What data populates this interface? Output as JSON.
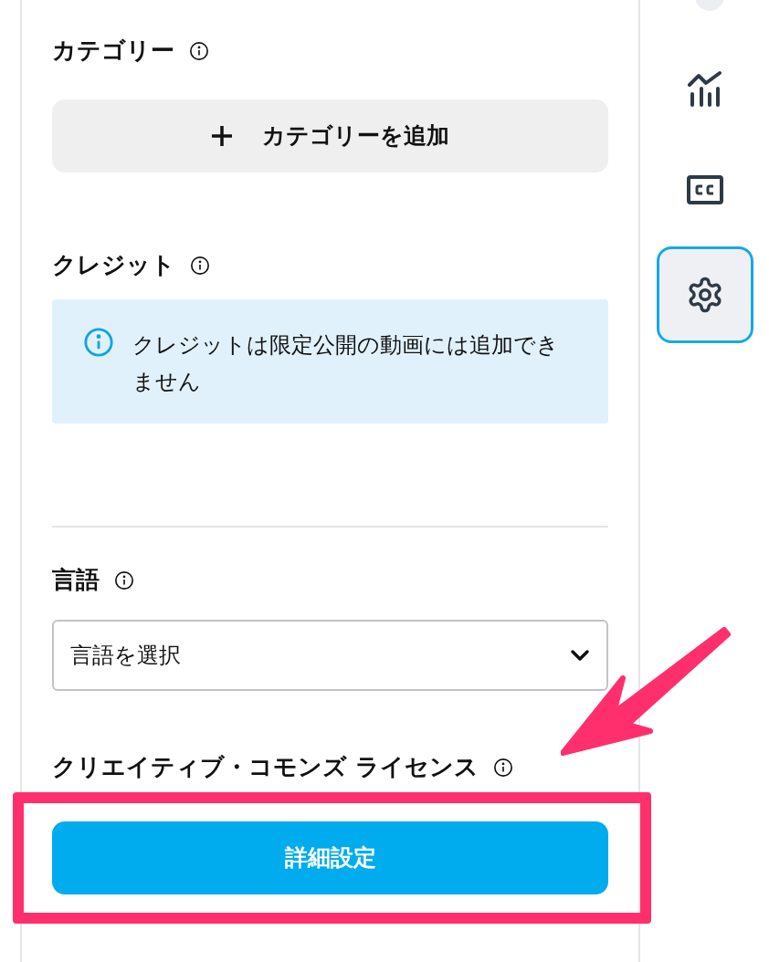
{
  "category": {
    "heading": "カテゴリー",
    "add_button": "カテゴリーを追加"
  },
  "credits": {
    "heading": "クレジット",
    "notice": "クレジットは限定公開の動画には追加できません"
  },
  "language": {
    "heading": "言語",
    "select": {
      "value": "言語を選択"
    }
  },
  "license": {
    "heading": "クリエイティブ・コモンズ ライセンス",
    "button": "詳細設定"
  },
  "rail": [
    {
      "kind": "analytics",
      "selected": false
    },
    {
      "kind": "subtitles",
      "selected": false
    },
    {
      "kind": "settings",
      "selected": true
    }
  ]
}
